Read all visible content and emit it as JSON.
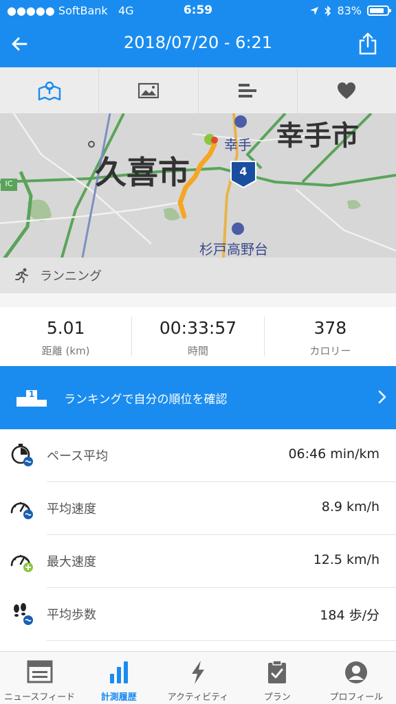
{
  "status_bar": {
    "carrier": "SoftBank",
    "network": "4G",
    "time": "6:59",
    "battery": "83%",
    "battery_level": 0.83
  },
  "header": {
    "title": "2018/07/20 - 6:21",
    "back_icon": "arrow-left-icon",
    "share_icon": "share-icon"
  },
  "tabs": [
    {
      "icon": "map-icon",
      "active": true
    },
    {
      "icon": "photo-icon",
      "active": false
    },
    {
      "icon": "bars-icon",
      "active": false
    },
    {
      "icon": "heart-icon",
      "active": false
    }
  ],
  "map": {
    "labels": {
      "city_main": "久喜市",
      "city_right": "幸手市",
      "station_top": "幸手",
      "station_bottom": "杉戸高野台",
      "route_number": "4",
      "ic_badge": "IC"
    },
    "caption": "ランニング"
  },
  "summary": {
    "distance": {
      "value": "5.01",
      "label": "距離 (km)"
    },
    "time": {
      "value": "00:33:57",
      "label": "時間"
    },
    "calories": {
      "value": "378",
      "label": "カロリー"
    }
  },
  "banner": {
    "text": "ランキングで自分の順位を確認",
    "podium_rank": "1"
  },
  "details": [
    {
      "label": "ペース平均",
      "value": "06:46 min/km",
      "icon": "pace-stopwatch-icon"
    },
    {
      "label": "平均速度",
      "value": "8.9 km/h",
      "icon": "speedometer-average-icon"
    },
    {
      "label": "最大速度",
      "value": "12.5 km/h",
      "icon": "speedometer-max-icon"
    },
    {
      "label": "平均歩数",
      "value": "184 歩/分",
      "icon": "footsteps-icon"
    }
  ],
  "bottom_nav": [
    {
      "label": "ニュースフィード",
      "icon": "newsfeed-icon",
      "active": false
    },
    {
      "label": "計測履歴",
      "icon": "history-bars-icon",
      "active": true
    },
    {
      "label": "アクティビティ",
      "icon": "lightning-icon",
      "active": false
    },
    {
      "label": "プラン",
      "icon": "clipboard-icon",
      "active": false
    },
    {
      "label": "プロフィール",
      "icon": "profile-icon",
      "active": false
    }
  ],
  "colors": {
    "accent": "#1a8cf0",
    "route_start": "#8cc63f",
    "route_line": "#f5a623",
    "route_end": "#e8472a"
  }
}
